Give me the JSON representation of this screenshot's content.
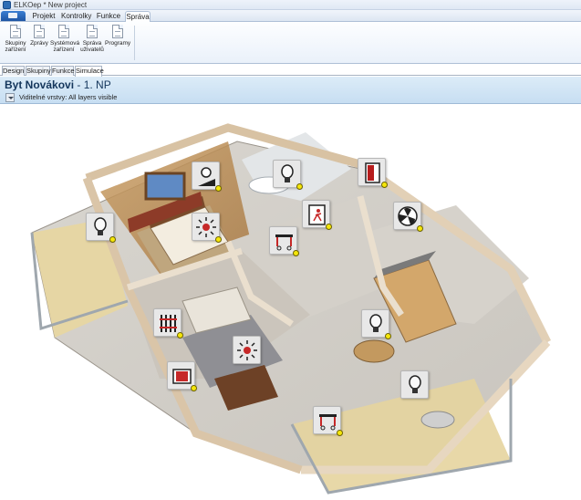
{
  "window": {
    "title": "ELKOep * New project",
    "icon": "app-logo-icon"
  },
  "menu": {
    "tabs": [
      {
        "label": "Projekt"
      },
      {
        "label": "Kontrolky"
      },
      {
        "label": "Funkce"
      },
      {
        "label": "Správa",
        "active": true
      }
    ]
  },
  "ribbon": {
    "buttons": [
      {
        "line1": "Skupiny",
        "line2": "zařízení",
        "icon": "document-icon"
      },
      {
        "line1": "Zprávy",
        "line2": "",
        "icon": "document-icon"
      },
      {
        "line1": "Systémová",
        "line2": "zařízení",
        "icon": "document-icon"
      },
      {
        "line1": "Správa",
        "line2": "uživatelů",
        "icon": "document-icon"
      },
      {
        "line1": "Programy",
        "line2": "",
        "icon": "document-icon"
      }
    ]
  },
  "view_tabs": [
    {
      "label": "Design"
    },
    {
      "label": "Skupiny"
    },
    {
      "label": "Funkce"
    },
    {
      "label": "Simulace",
      "active": true
    }
  ],
  "header": {
    "title_bold": "Byt Novákovi",
    "title_rest": " - 1. NP",
    "layers_label": "Viditelné vrstvy:",
    "layers_value": "All layers visible"
  },
  "colors": {
    "accent": "#1e55a3",
    "status_on": "#f5e60a",
    "header_bg": "#c7def2"
  },
  "devices": [
    {
      "name": "bulb-device-bedroom",
      "icon": "light-bulb-icon"
    },
    {
      "name": "dimmer-device-bedroom-wall",
      "icon": "dimmer-light-icon"
    },
    {
      "name": "light-device-bedroom",
      "icon": "ceiling-light-icon"
    },
    {
      "name": "bulb-device-bathroom",
      "icon": "light-bulb-icon"
    },
    {
      "name": "door-device-hall",
      "icon": "door-icon"
    },
    {
      "name": "exit-device-hall",
      "icon": "exit-door-icon"
    },
    {
      "name": "shutter-device-hall",
      "icon": "roller-shutter-icon"
    },
    {
      "name": "fan-device-kitchen",
      "icon": "fan-icon"
    },
    {
      "name": "heater-device-living",
      "icon": "radiator-icon"
    },
    {
      "name": "light-device-living",
      "icon": "ceiling-light-icon"
    },
    {
      "name": "bulb-device-dining",
      "icon": "light-bulb-icon"
    },
    {
      "name": "window-device-living",
      "icon": "window-icon"
    },
    {
      "name": "bulb-device-terrace",
      "icon": "light-bulb-icon"
    },
    {
      "name": "shutter-device-terrace",
      "icon": "roller-shutter-icon"
    }
  ]
}
